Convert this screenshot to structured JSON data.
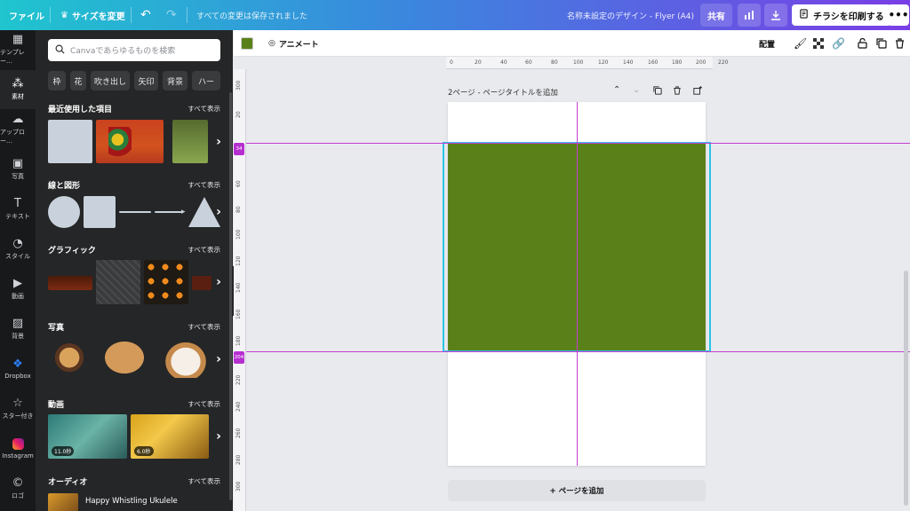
{
  "topbar": {
    "file": "ファイル",
    "resize": "サイズを変更",
    "saved_status": "すべての変更は保存されました",
    "doc_title": "名称未設定のデザイン - Flyer (A4)",
    "share": "共有",
    "print": "チラシを印刷する",
    "more": "•••"
  },
  "rail": [
    {
      "label": "テンプレー…",
      "icon": "template-icon"
    },
    {
      "label": "素材",
      "icon": "elements-icon"
    },
    {
      "label": "アップロー…",
      "icon": "upload-icon"
    },
    {
      "label": "写真",
      "icon": "photo-icon"
    },
    {
      "label": "テキスト",
      "icon": "text-icon"
    },
    {
      "label": "スタイル",
      "icon": "style-icon"
    },
    {
      "label": "動画",
      "icon": "video-icon"
    },
    {
      "label": "背景",
      "icon": "background-icon"
    },
    {
      "label": "Dropbox",
      "icon": "dropbox-icon"
    },
    {
      "label": "スター付き",
      "icon": "star-icon"
    },
    {
      "label": "Instagram",
      "icon": "instagram-icon"
    },
    {
      "label": "ロゴ",
      "icon": "logo-icon"
    }
  ],
  "panel": {
    "search_placeholder": "Canvaであらゆるものを検索",
    "chips": [
      "枠",
      "花",
      "吹き出し",
      "矢印",
      "背景",
      "ハー"
    ],
    "see_all": "すべて表示",
    "sections": {
      "recent": "最近使用した項目",
      "shapes": "線と図形",
      "graphics": "グラフィック",
      "photos": "写真",
      "videos": "動画",
      "audio": "オーディオ"
    },
    "video_durations": [
      "11.0秒",
      "6.0秒"
    ],
    "audio_title": "Happy Whistling Ukulele"
  },
  "ctxbar": {
    "animate": "アニメート",
    "arrange": "配置",
    "fill_color": "#5a8119"
  },
  "ruler_top": [
    "0",
    "20",
    "40",
    "60",
    "80",
    "100",
    "120",
    "140",
    "160",
    "180",
    "200",
    "220"
  ],
  "ruler_left": [
    "300",
    "20",
    "34",
    "60",
    "80",
    "100",
    "120",
    "140",
    "160",
    "180",
    "204",
    "220",
    "240",
    "260",
    "280",
    "300"
  ],
  "guides": {
    "top_label": "34",
    "bottom_label": "204"
  },
  "page": {
    "header": "2ページ - ページタイトルを追加",
    "add_page": "+ ページを追加"
  }
}
